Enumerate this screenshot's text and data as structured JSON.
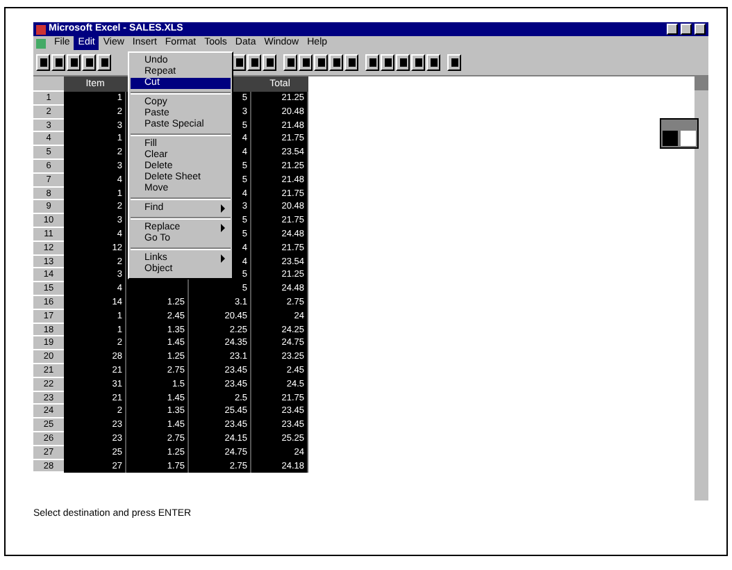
{
  "window": {
    "title": "Microsoft Excel - SALES.XLS"
  },
  "menu_bar": [
    {
      "label": "File",
      "selected": false
    },
    {
      "label": "Edit",
      "selected": true
    },
    {
      "label": "View",
      "selected": false
    },
    {
      "label": "Insert",
      "selected": false
    },
    {
      "label": "Format",
      "selected": false
    },
    {
      "label": "Tools",
      "selected": false
    },
    {
      "label": "Data",
      "selected": false
    },
    {
      "label": "Window",
      "selected": false
    },
    {
      "label": "Help",
      "selected": false
    }
  ],
  "open_menu": {
    "items": [
      {
        "kind": "item",
        "label": "Undo",
        "selected": false,
        "submenu": false
      },
      {
        "kind": "item",
        "label": "Repeat",
        "selected": false,
        "submenu": false
      },
      {
        "kind": "item",
        "label": "Cut",
        "selected": true,
        "submenu": false
      },
      {
        "kind": "separator"
      },
      {
        "kind": "item",
        "label": "Copy",
        "selected": false,
        "submenu": false
      },
      {
        "kind": "item",
        "label": "Paste",
        "selected": false,
        "submenu": false
      },
      {
        "kind": "item",
        "label": "Paste Special",
        "selected": false,
        "submenu": false
      },
      {
        "kind": "separator"
      },
      {
        "kind": "item",
        "label": "Fill",
        "selected": false,
        "submenu": false
      },
      {
        "kind": "item",
        "label": "Clear",
        "selected": false,
        "submenu": false
      },
      {
        "kind": "item",
        "label": "Delete",
        "selected": false,
        "submenu": false
      },
      {
        "kind": "item",
        "label": "Delete Sheet",
        "selected": false,
        "submenu": false
      },
      {
        "kind": "item",
        "label": "Move",
        "selected": false,
        "submenu": false
      },
      {
        "kind": "separator"
      },
      {
        "kind": "item",
        "label": "Find",
        "selected": false,
        "submenu": true
      },
      {
        "kind": "separator"
      },
      {
        "kind": "item",
        "label": "Replace",
        "selected": false,
        "submenu": true
      },
      {
        "kind": "item",
        "label": "Go To",
        "selected": false,
        "submenu": false
      },
      {
        "kind": "separator"
      },
      {
        "kind": "item",
        "label": "Links",
        "selected": false,
        "submenu": true
      },
      {
        "kind": "item",
        "label": "Object",
        "selected": false,
        "submenu": false
      }
    ]
  },
  "sheet": {
    "column_headers": {
      "a": "Item",
      "d": "Total"
    },
    "rows": [
      {
        "row": "1",
        "a": "1",
        "c": "5",
        "d": "21.25"
      },
      {
        "row": "2",
        "a": "2",
        "c": "3",
        "d": "20.48"
      },
      {
        "row": "3",
        "a": "3",
        "c": "5",
        "d": "21.48"
      },
      {
        "row": "4",
        "a": "1",
        "c": "4",
        "d": "21.75"
      },
      {
        "row": "5",
        "a": "2",
        "c": "4",
        "d": "23.54"
      },
      {
        "row": "6",
        "a": "3",
        "c": "5",
        "d": "21.25"
      },
      {
        "row": "7",
        "a": "4",
        "c": "5",
        "d": "21.48"
      },
      {
        "row": "8",
        "a": "1",
        "c": "4",
        "d": "21.75"
      },
      {
        "row": "9",
        "a": "2",
        "c": "3",
        "d": "20.48"
      },
      {
        "row": "10",
        "a": "3",
        "c": "5",
        "d": "21.75"
      },
      {
        "row": "11",
        "a": "4",
        "c": "5",
        "d": "24.48"
      },
      {
        "row": "12",
        "a": "12",
        "c": "4",
        "d": "21.75"
      },
      {
        "row": "13",
        "a": "2",
        "c": "4",
        "d": "23.54"
      },
      {
        "row": "14",
        "a": "3",
        "c": "5",
        "d": "21.25"
      },
      {
        "row": "15",
        "a": "4",
        "c": "5",
        "d": "24.48"
      },
      {
        "row": "16",
        "a": "14",
        "b": "1.25",
        "c": "3.1",
        "d": "2.75"
      },
      {
        "row": "17",
        "a": "1",
        "b": "2.45",
        "c": "20.45",
        "d": "24"
      },
      {
        "row": "18",
        "a": "1",
        "b": "1.35",
        "c": "2.25",
        "d": "24.25"
      },
      {
        "row": "19",
        "a": "2",
        "b": "1.45",
        "c": "24.35",
        "d": "24.75"
      },
      {
        "row": "20",
        "a": "28",
        "b": "1.25",
        "c": "23.1",
        "d": "23.25"
      },
      {
        "row": "21",
        "a": "21",
        "b": "2.75",
        "c": "23.45",
        "d": "2.45"
      },
      {
        "row": "22",
        "a": "31",
        "b": "1.5",
        "c": "23.45",
        "d": "24.5"
      },
      {
        "row": "23",
        "a": "21",
        "b": "1.45",
        "c": "2.5",
        "d": "21.75"
      },
      {
        "row": "24",
        "a": "2",
        "b": "1.35",
        "c": "25.45",
        "d": "23.45"
      },
      {
        "row": "25",
        "a": "23",
        "b": "1.45",
        "c": "23.45",
        "d": "23.45"
      },
      {
        "row": "26",
        "a": "23",
        "b": "2.75",
        "c": "24.15",
        "d": "25.25"
      },
      {
        "row": "27",
        "a": "25",
        "b": "1.25",
        "c": "24.75",
        "d": "24"
      },
      {
        "row": "28",
        "a": "27",
        "b": "1.75",
        "c": "2.75",
        "d": "24.18"
      }
    ]
  },
  "status_bar": {
    "text": "Select destination and press ENTER"
  }
}
